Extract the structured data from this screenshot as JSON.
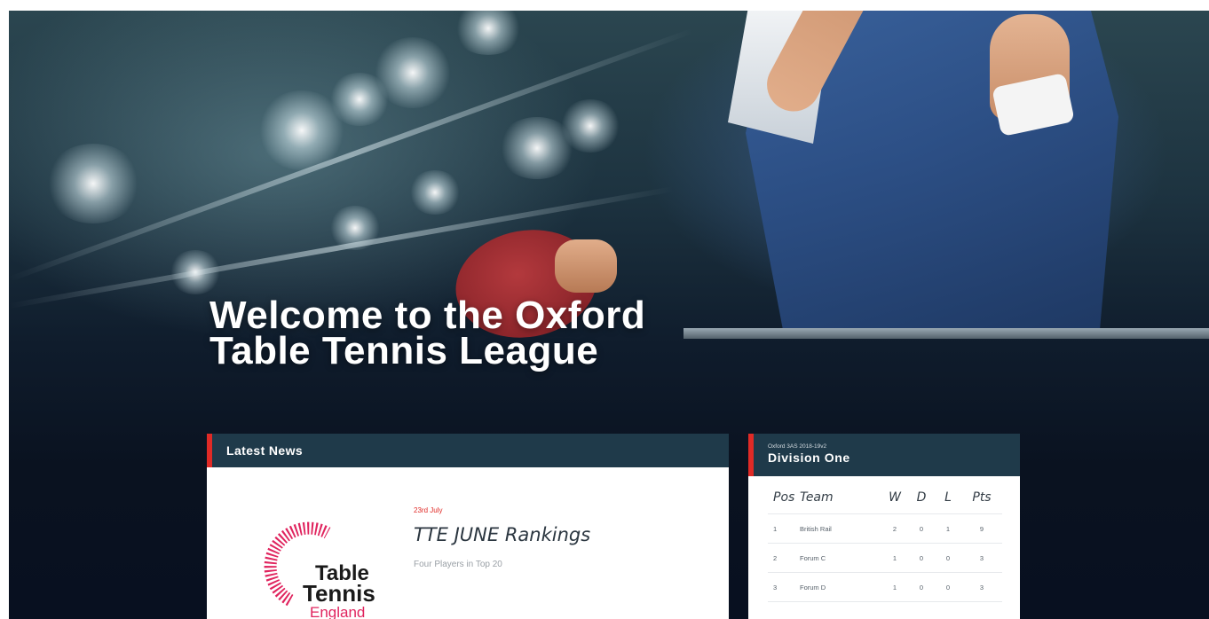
{
  "hero": {
    "title_line1": "Welcome to the Oxford",
    "title_line2": "Table Tennis League"
  },
  "news": {
    "header": "Latest News",
    "item": {
      "date": "23rd July",
      "title": "TTE JUNE Rankings",
      "summary": "Four Players in Top 20",
      "logo": {
        "word1": "Table",
        "word2": "Tennis",
        "word3": "England"
      }
    }
  },
  "league": {
    "season": "Oxford 3AS 2018-19v2",
    "title": "Division One",
    "columns": [
      "Pos",
      "Team",
      "W",
      "D",
      "L",
      "Pts"
    ],
    "rows": [
      {
        "pos": "1",
        "team": "British Rail",
        "w": "2",
        "d": "0",
        "l": "1",
        "pts": "9"
      },
      {
        "pos": "2",
        "team": "Forum C",
        "w": "1",
        "d": "0",
        "l": "0",
        "pts": "3"
      },
      {
        "pos": "3",
        "team": "Forum D",
        "w": "1",
        "d": "0",
        "l": "0",
        "pts": "3"
      }
    ]
  },
  "colors": {
    "accent": "#e02a26",
    "panel_header": "#1f3a4a",
    "hero_dark": "#0a1220"
  }
}
